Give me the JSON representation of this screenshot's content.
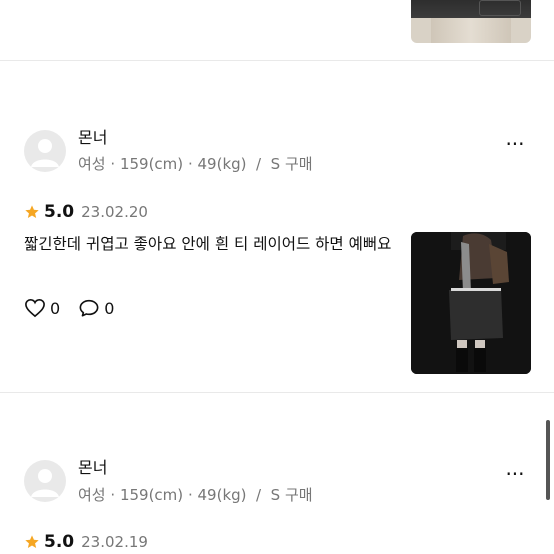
{
  "reviews": [
    {
      "user": "몬너",
      "gender": "여성",
      "height": "159(cm)",
      "weight": "49(kg)",
      "size": "S 구매",
      "rating": "5.0",
      "date": "23.02.20",
      "text": "짧긴한데 귀엽고 좋아요 안에 흰 티 레이어드 하면 예뻐요",
      "likes": "0",
      "comments": "0"
    },
    {
      "user": "몬너",
      "gender": "여성",
      "height": "159(cm)",
      "weight": "49(kg)",
      "size": "S 구매",
      "rating": "5.0",
      "date": "23.02.19"
    }
  ],
  "separator": "·",
  "slash": "/",
  "more_glyph": "···",
  "colors": {
    "star": "#F5A623",
    "meta": "#777777",
    "divider": "#E9E9E9"
  },
  "icons": {
    "star": "star-icon",
    "heart": "heart-icon",
    "comment": "comment-icon",
    "more": "more-icon"
  }
}
